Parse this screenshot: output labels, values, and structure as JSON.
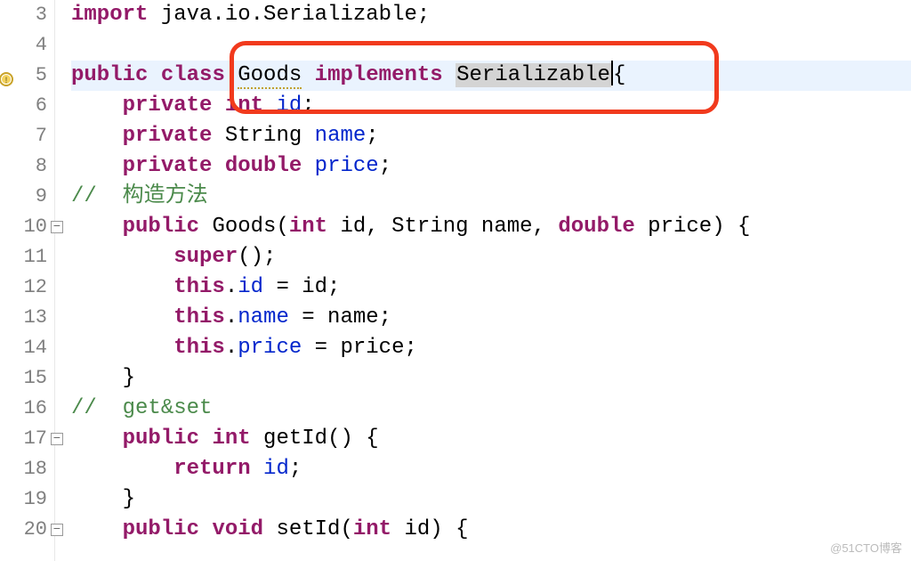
{
  "gutter": {
    "lines": [
      {
        "num": "3",
        "fold": false,
        "warn": false
      },
      {
        "num": "4",
        "fold": false,
        "warn": false
      },
      {
        "num": "5",
        "fold": false,
        "warn": true
      },
      {
        "num": "6",
        "fold": false,
        "warn": false
      },
      {
        "num": "7",
        "fold": false,
        "warn": false
      },
      {
        "num": "8",
        "fold": false,
        "warn": false
      },
      {
        "num": "9",
        "fold": false,
        "warn": false
      },
      {
        "num": "10",
        "fold": true,
        "warn": false
      },
      {
        "num": "11",
        "fold": false,
        "warn": false
      },
      {
        "num": "12",
        "fold": false,
        "warn": false
      },
      {
        "num": "13",
        "fold": false,
        "warn": false
      },
      {
        "num": "14",
        "fold": false,
        "warn": false
      },
      {
        "num": "15",
        "fold": false,
        "warn": false
      },
      {
        "num": "16",
        "fold": false,
        "warn": false
      },
      {
        "num": "17",
        "fold": true,
        "warn": false
      },
      {
        "num": "18",
        "fold": false,
        "warn": false
      },
      {
        "num": "19",
        "fold": false,
        "warn": false
      },
      {
        "num": "20",
        "fold": true,
        "warn": false
      }
    ]
  },
  "tokens": {
    "import": "import",
    "public": "public",
    "class": "class",
    "private": "private",
    "int": "int",
    "double": "double",
    "void": "void",
    "this": "this",
    "super": "super",
    "return": "return",
    "implements": "implements",
    "goods": "Goods",
    "serializable": "Serializable",
    "string": "String",
    "pkgtext": " java.io.Serializable;",
    "id": "id",
    "name": "name",
    "price": "price",
    "idparam": " id",
    "nameparam": " name",
    "priceparam": " price",
    "comment1": "//  构造方法",
    "comment2": "//  get&set",
    "getid": " getId() {",
    "setid": " setId(",
    "eq_id": " = id;",
    "eq_name": " = name;",
    "eq_price": " = price;",
    "watermark": "@51CTO博客"
  }
}
